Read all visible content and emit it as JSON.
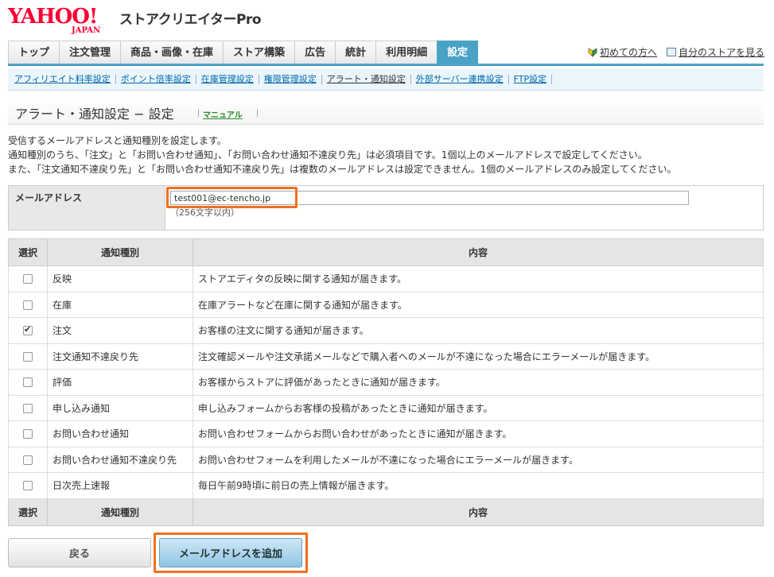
{
  "header": {
    "logo_text": "YAHOO!",
    "logo_sub": "JAPAN",
    "app_title": "ストアクリエイターPro"
  },
  "mainnav": {
    "tabs": [
      "トップ",
      "注文管理",
      "商品・画像・在庫",
      "ストア構築",
      "広告",
      "統計",
      "利用明細",
      "設定"
    ],
    "links": [
      "初めての方へ",
      "自分のストアを見る"
    ]
  },
  "subnav": [
    "アフィリエイト料率設定",
    "ポイント倍率設定",
    "在庫管理設定",
    "権限管理設定",
    "アラート・通知設定",
    "外部サーバー連携設定",
    "FTP設定"
  ],
  "page": {
    "title": "アラート・通知設定 − 設定",
    "manual": "マニュアル"
  },
  "description": [
    "受信するメールアドレスと通知種別を設定します。",
    "通知種別のうち、「注文」と「お問い合わせ通知」、「お問い合わせ通知不達戻り先」は必須項目です。1個以上のメールアドレスで設定してください。",
    "また、「注文通知不達戻り先」と「お問い合わせ通知不達戻り先」は複数のメールアドレスは設定できません。1個のメールアドレスのみ設定してください。"
  ],
  "email": {
    "label": "メールアドレス",
    "value": "test001@ec-tencho.jp",
    "hint": "（256文字以内）"
  },
  "table": {
    "headers": [
      "選択",
      "通知種別",
      "内容"
    ],
    "rows": [
      {
        "checked": false,
        "kind": "反映",
        "content": "ストアエディタの反映に関する通知が届きます。"
      },
      {
        "checked": false,
        "kind": "在庫",
        "content": "在庫アラートなど在庫に関する通知が届きます。"
      },
      {
        "checked": true,
        "kind": "注文",
        "content": "お客様の注文に関する通知が届きます。"
      },
      {
        "checked": false,
        "kind": "注文通知不達戻り先",
        "content": "注文確認メールや注文承諾メールなどで購入者へのメールが不達になった場合にエラーメールが届きます。"
      },
      {
        "checked": false,
        "kind": "評価",
        "content": "お客様からストアに評価があったときに通知が届きます。"
      },
      {
        "checked": false,
        "kind": "申し込み通知",
        "content": "申し込みフォームからお客様の投稿があったときに通知が届きます。"
      },
      {
        "checked": false,
        "kind": "お問い合わせ通知",
        "content": "お問い合わせフォームからお問い合わせがあったときに通知が届きます。"
      },
      {
        "checked": false,
        "kind": "お問い合わせ通知不達戻り先",
        "content": "お問い合わせフォームを利用したメールが不達になった場合にエラーメールが届きます。"
      },
      {
        "checked": false,
        "kind": "日次売上速報",
        "content": "毎日午前9時頃に前日の売上情報が届きます。"
      }
    ]
  },
  "buttons": {
    "back": "戻る",
    "add": "メールアドレスを追加"
  }
}
